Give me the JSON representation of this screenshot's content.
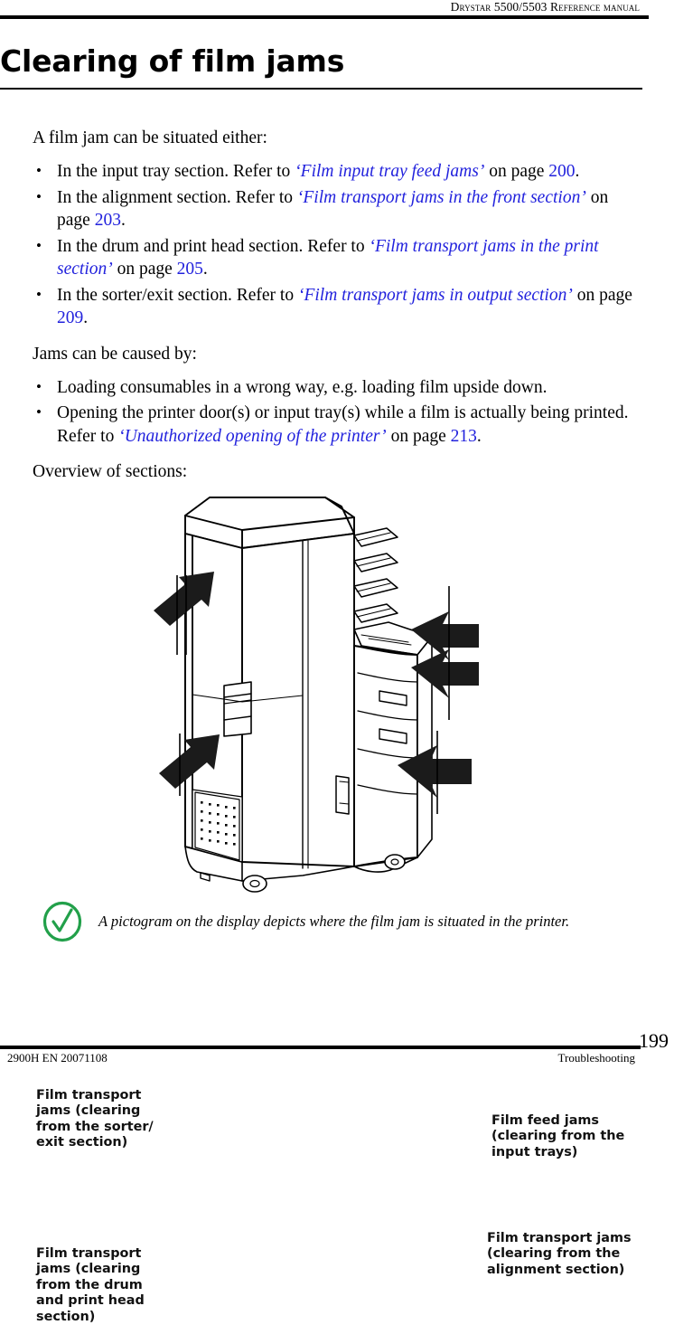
{
  "header": {
    "running_title": "Drystar 5500/5503 Reference manual"
  },
  "title": "Clearing of film jams",
  "body": {
    "intro": "A film jam can be situated either:",
    "location_bullets": [
      {
        "lead": "In the input tray section. Refer to ",
        "xref": "‘Film input tray feed jams’",
        "mid": " on page ",
        "page": "200",
        "tail": "."
      },
      {
        "lead": "In the alignment section. Refer to ",
        "xref": "‘Film transport jams in the front section’",
        "mid": " on page ",
        "page": "203",
        "tail": "."
      },
      {
        "lead": "In the drum and print head section. Refer to ",
        "xref": "‘Film transport jams in the print section’",
        "mid": " on page ",
        "page": "205",
        "tail": "."
      },
      {
        "lead": "In the sorter/exit section. Refer to ",
        "xref": "‘Film transport jams in output section’",
        "mid": " on page ",
        "page": "209",
        "tail": "."
      }
    ],
    "causes_intro": "Jams can be caused by:",
    "cause_bullets": [
      {
        "lead": "Loading consumables in a wrong way, e.g. loading film upside down.",
        "xref": "",
        "mid": "",
        "page": "",
        "tail": ""
      },
      {
        "lead": "Opening the printer door(s) or input tray(s) while a film is actually being printed. Refer to ",
        "xref": "‘Unauthorized opening of the printer’",
        "mid": " on page ",
        "page": "213",
        "tail": "."
      }
    ],
    "overview_intro": "Overview of sections:"
  },
  "figure": {
    "alt": "printer-line-drawing",
    "labels": {
      "sorter_exit": "Film transport jams (clearing from the sorter/ exit section)",
      "drum_printhead": "Film transport jams (clearing from the drum and print head section)",
      "film_feed": "Film feed jams (clearing from the input trays)",
      "alignment": "Film transport jams (clearing from the alignment section)"
    }
  },
  "note": {
    "icon": "green-check-circle-icon",
    "icon_color": "#22a04a",
    "text": "A pictogram on the display depicts where the film jam is situated in the printer."
  },
  "footer": {
    "doc_id": "2900H EN 20071108",
    "section": "Troubleshooting",
    "page_number": "199"
  }
}
